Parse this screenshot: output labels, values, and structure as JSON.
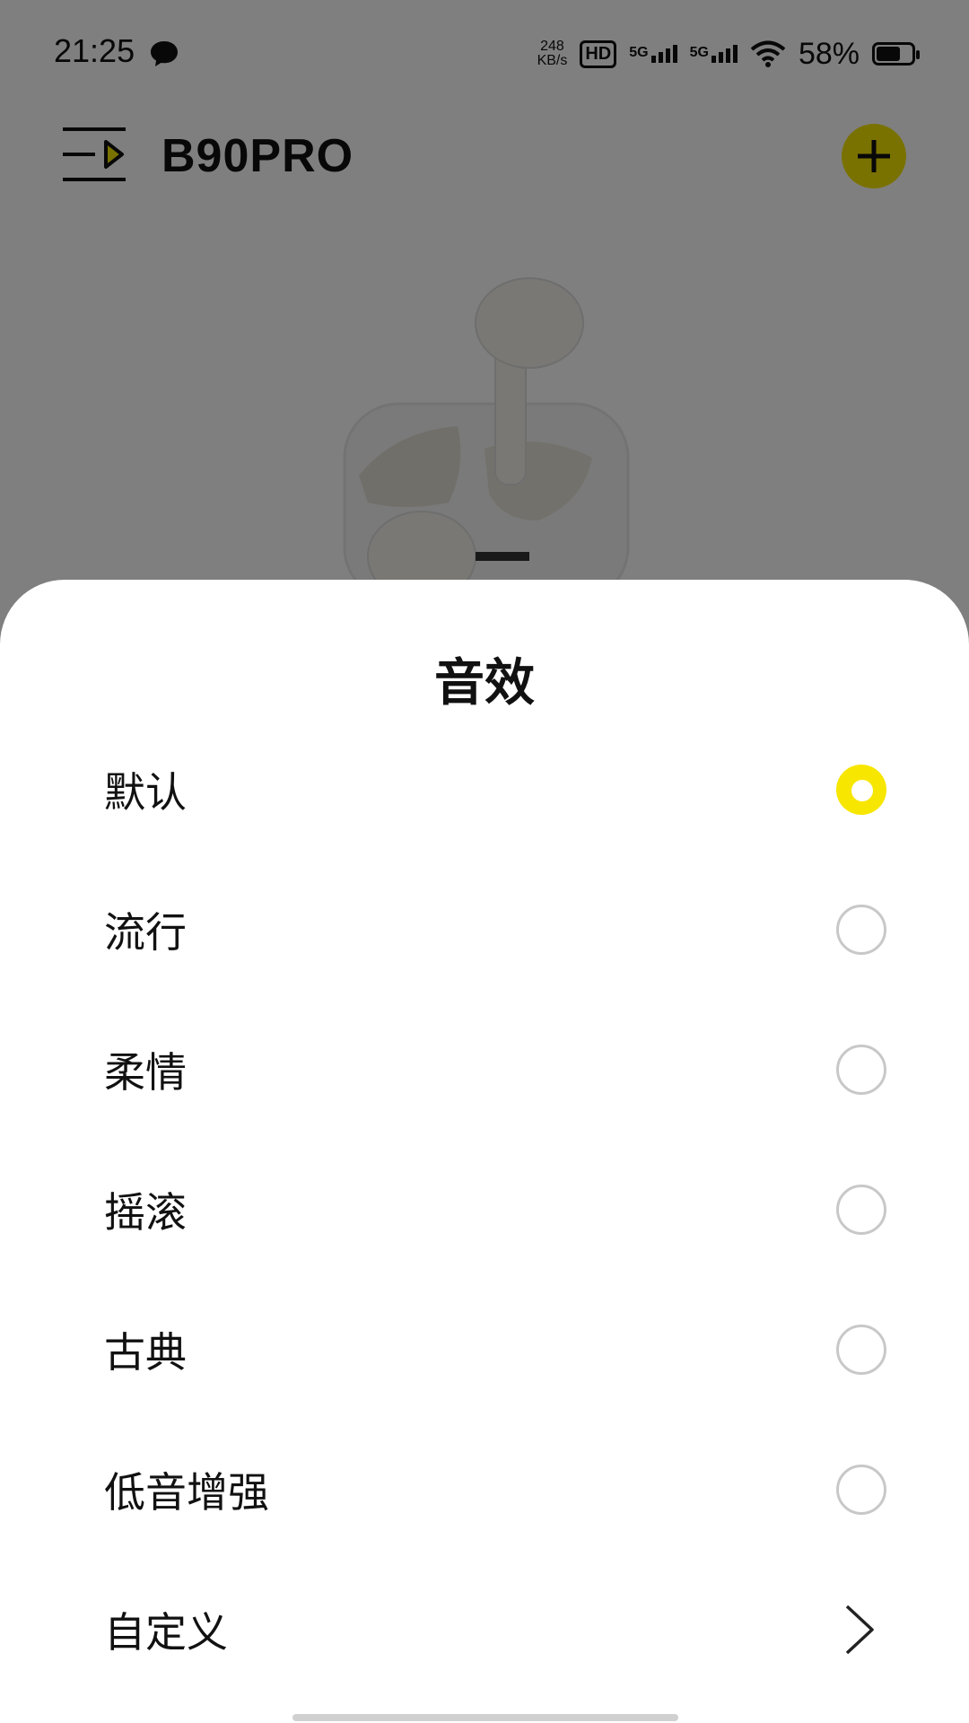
{
  "status_bar": {
    "time": "21:25",
    "net_speed_value": "248",
    "net_speed_unit": "KB/s",
    "hd_label": "HD",
    "sim1_label": "5G",
    "sim2_label": "5G",
    "battery_percent": "58%"
  },
  "header": {
    "title": "B90PRO",
    "add_icon": "plus-icon",
    "menu_icon": "menu-icon"
  },
  "sheet": {
    "title": "音效",
    "options": [
      {
        "label": "默认",
        "selected": true
      },
      {
        "label": "流行",
        "selected": false
      },
      {
        "label": "柔情",
        "selected": false
      },
      {
        "label": "摇滚",
        "selected": false
      },
      {
        "label": "古典",
        "selected": false
      },
      {
        "label": "低音增强",
        "selected": false
      }
    ],
    "custom_label": "自定义",
    "custom_icon": "chevron-right-icon"
  },
  "colors": {
    "accent": "#f7e600",
    "overlay": "rgba(0,0,0,0.5)",
    "radio_border": "#c8c8c8"
  }
}
